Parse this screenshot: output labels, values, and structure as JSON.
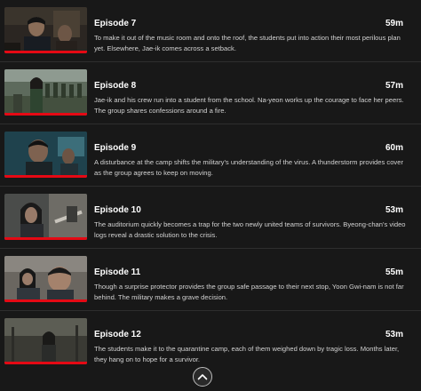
{
  "episodes": [
    {
      "title": "Episode 7",
      "duration": "59m",
      "description": "To make it out of the music room and onto the roof, the students put into action their most perilous plan yet. Elsewhere, Jae-ik comes across a setback.",
      "progress": 1.0,
      "thumbnail_icon": "episode-7-still"
    },
    {
      "title": "Episode 8",
      "duration": "57m",
      "description": "Jae-ik and his crew run into a student from the school. Na-yeon works up the courage to face her peers. The group shares confessions around a fire.",
      "progress": 1.0,
      "thumbnail_icon": "episode-8-still"
    },
    {
      "title": "Episode 9",
      "duration": "60m",
      "description": "A disturbance at the camp shifts the military's understanding of the virus. A thunderstorm provides cover as the group agrees to keep on moving.",
      "progress": 1.0,
      "thumbnail_icon": "episode-9-still"
    },
    {
      "title": "Episode 10",
      "duration": "53m",
      "description": "The auditorium quickly becomes a trap for the two newly united teams of survivors. Byeong-chan's video logs reveal a drastic solution to the crisis.",
      "progress": 1.0,
      "thumbnail_icon": "episode-10-still"
    },
    {
      "title": "Episode 11",
      "duration": "55m",
      "description": "Though a surprise protector provides the group safe passage to their next stop, Yoon Gwi-nam is not far behind. The military makes a grave decision.",
      "progress": 1.0,
      "thumbnail_icon": "episode-11-still"
    },
    {
      "title": "Episode 12",
      "duration": "53m",
      "description": "The students make it to the quarantine camp, each of them weighed down by tragic loss. Months later, they hang on to hope for a survivor.",
      "progress": 1.0,
      "thumbnail_icon": "episode-12-still"
    }
  ],
  "collapse_icon": "chevron-up-icon",
  "colors": {
    "background": "#181818",
    "progress": "#e50914",
    "divider": "#2e2e2e"
  }
}
